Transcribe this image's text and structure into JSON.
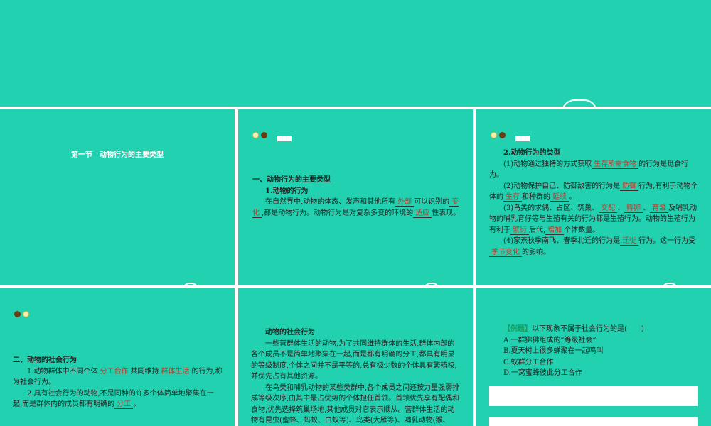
{
  "slide1": {
    "title": "第一节　动物行为的主要类型"
  },
  "slide2": {
    "heading": "一、动物行为的主要类型",
    "sub": "1.动物的行为",
    "p1a": "在自然界中,动物的体态、发声和其他所有",
    "f1": "外部",
    "p1b": "可以识别的",
    "f2": "变化",
    "p1c": ",都是动物行为。动物行为是对复杂多变的环境的",
    "f3": "适应",
    "p1d": "性表现。"
  },
  "slide3": {
    "sub": "2.动物行为的类型",
    "a1": "(1)动物通过独特的方式获取",
    "af1": "生存所需食物",
    "a2": "的行为是觅食行为。",
    "b1": "(2)动物保护自己、防御敌害的行为是",
    "bf1": "防御",
    "b2": "行为,有利于动物个体的",
    "bf2": "生存",
    "b3": "和种群的",
    "bf3": "延续",
    "b4": "。",
    "c1": "(3)鸟类的求偶、占区、筑巢、",
    "cf1": "交配",
    "c2": "、",
    "cf2": "孵卵",
    "c3": "、",
    "cf3": "育雏",
    "c4": "及哺乳动物的哺乳育仔等与生殖有关的行为都是生殖行为。动物的生殖行为有利于",
    "cf4": "繁衍",
    "c5": "后代,",
    "cf5": "增加",
    "c6": "个体数量。",
    "d1": "(4)家燕秋季南飞、春季北迁的行为是",
    "df1": "迁徙",
    "d2": "行为。这一行为受",
    "df2": "季节变化",
    "d3": "的影响。"
  },
  "slide4": {
    "heading": "二、动物的社会行为",
    "i1a": "1.动物群体中不同个体",
    "i1f1": "分工合作",
    "i1b": "共同维持",
    "i1f2": "群体生活",
    "i1c": "的行为,称为社会行为。",
    "i2a": "2.具有社会行为的动物,不是同种的许多个体简单地聚集在一起,而是群体内的成员都有明确的",
    "i2f": "分工",
    "i2b": "。"
  },
  "slide5": {
    "heading": "动物的社会行为",
    "p1": "一些营群体生活的动物,为了共同维持群体的生活,群体内部的各个成员不是简单地聚集在一起,而是都有明确的分工,都具有明显的等级制度,个体之间并不是平等的,总有极少数的个体具有繁殖权,并优先占有其他资源。",
    "p2": "在鸟类和哺乳动物的某些类群中,各个成员之间还按力量强弱排成等级次序,由其中最占优势的个体担任首领。首领优先享有配偶和食物,优先选择筑巢场地,其他成员对它表示顺从。营群体生活的动物有昆虫(蜜蜂、蚂蚁、白蚁等)、鸟类(大雁等)、哺乳动物(猴、"
  },
  "slide6": {
    "label": "【例题】",
    "question": "以下现象不属于社会行为的是(　　)",
    "options": [
      "A.一群狒狒组成的“等级社会”",
      "B.夏天树上很多蝉聚在一起鸣叫",
      "C.蚁群分工合作",
      "D.一窝蜜蜂彼此分工合作"
    ]
  }
}
